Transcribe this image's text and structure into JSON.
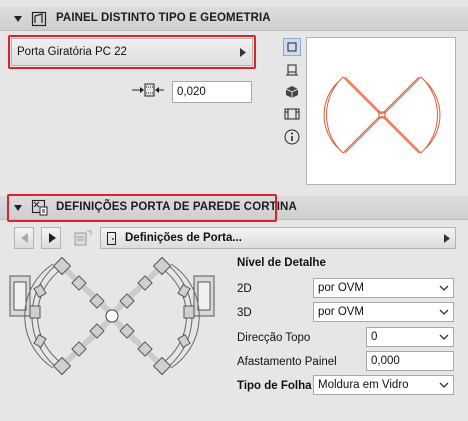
{
  "section1": {
    "title": "PAINEL DISTINTO TIPO E GEOMETRIA",
    "panel_selector": "Porta Giratória PC 22",
    "thickness_value": "0,020"
  },
  "section2": {
    "title": "DEFINIÇÕES PORTA DE PAREDE CORTINA",
    "page_selector": "Definições de Porta...",
    "detail_level_title": "Nível de Detalhe",
    "rows": [
      {
        "label": "2D",
        "value": "por OVM"
      },
      {
        "label": "3D",
        "value": "por OVM"
      },
      {
        "label": "Direcção Topo",
        "value": "0"
      },
      {
        "label": "Afastamento Painel",
        "value": "0,000"
      },
      {
        "label": "Tipo de Folha",
        "value": "Moldura em Vidro"
      }
    ]
  },
  "colors": {
    "highlight": "#e0202a",
    "preview_lines": "#d9603a"
  },
  "icons": [
    "collapse-triangle-icon",
    "door-settings-icon",
    "thickness-dimension-icon",
    "plan-view-icon",
    "section-view-icon",
    "3d-view-icon",
    "elevation-view-icon",
    "info-icon",
    "prev-page-icon",
    "next-page-icon",
    "page-list-icon",
    "door-page-icon",
    "chevron-right-icon",
    "chevron-down-icon"
  ]
}
